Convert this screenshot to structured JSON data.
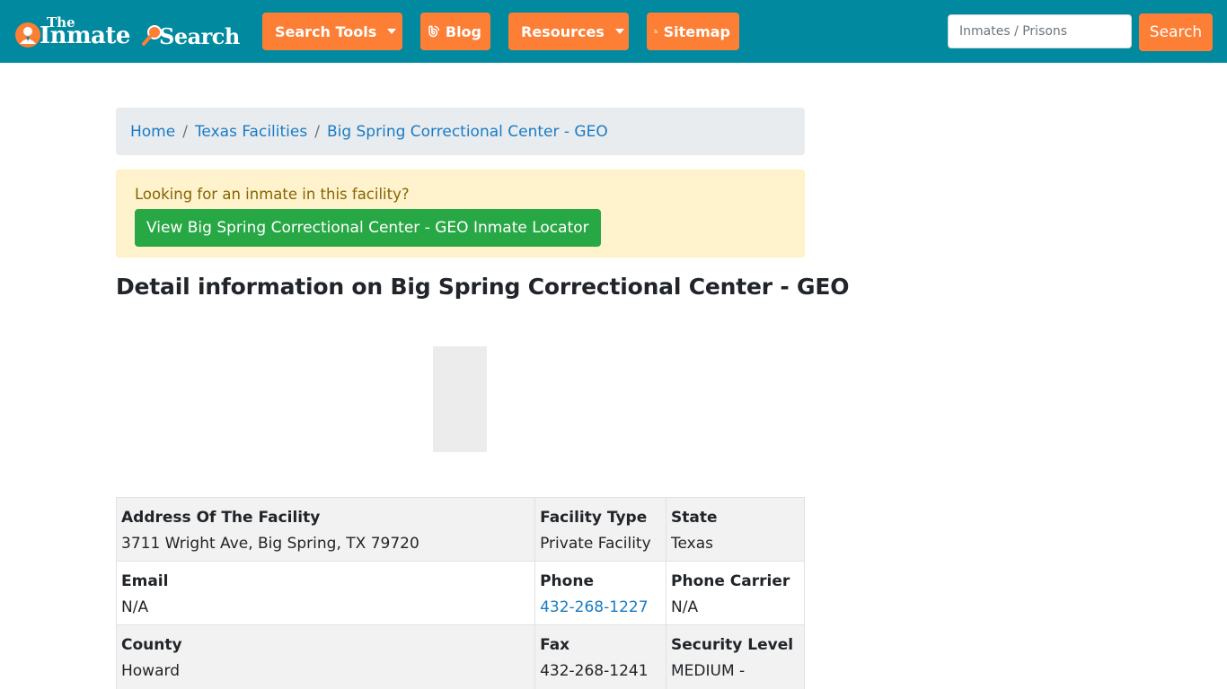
{
  "nav": {
    "logo_small": "The",
    "logo_word1": "Inmate",
    "logo_word2": "Search",
    "buttons": [
      {
        "label": "Search Tools",
        "icon": "search-gear-icon"
      },
      {
        "label": "Blog",
        "icon": "blog-icon"
      },
      {
        "label": "Resources",
        "icon": "leaf-icon"
      },
      {
        "label": "Sitemap",
        "icon": "rss-icon"
      }
    ],
    "search_placeholder": "Inmates / Prisons",
    "search_button": "Search"
  },
  "breadcrumb": {
    "home": "Home",
    "state": "Texas Facilities",
    "facility": "Big Spring Correctional Center - GEO",
    "separator": "/"
  },
  "alert": {
    "text": "Looking for an inmate in this facility?",
    "button": "View Big Spring Correctional Center - GEO Inmate Locator"
  },
  "heading": "Detail information on Big Spring Correctional Center - GEO",
  "details": {
    "address_label": "Address Of The Facility",
    "address_value": "3711 Wright Ave, Big Spring, TX 79720",
    "type_label": "Facility Type",
    "type_value": "Private Facility",
    "state_label": "State",
    "state_value": "Texas",
    "email_label": "Email",
    "email_value": "N/A",
    "phone_label": "Phone",
    "phone_value": "432-268-1227",
    "carrier_label": "Phone Carrier",
    "carrier_value": "N/A",
    "county_label": "County",
    "county_value": "Howard",
    "fax_label": "Fax",
    "fax_value": "432-268-1241",
    "security_label": "Security Level",
    "security_value": "MEDIUM - general"
  },
  "colors": {
    "navbar": "#00899f",
    "accent_orange": "#fd7e35",
    "link_blue": "#1a7bc4",
    "success_green": "#28a745",
    "alert_bg": "#fff3cd"
  }
}
